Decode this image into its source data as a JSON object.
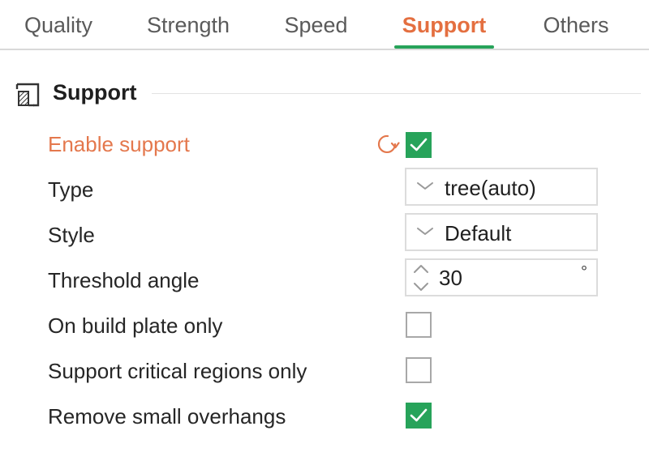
{
  "tabs": [
    {
      "label": "Quality",
      "active": false
    },
    {
      "label": "Strength",
      "active": false
    },
    {
      "label": "Speed",
      "active": false
    },
    {
      "label": "Support",
      "active": true
    },
    {
      "label": "Others",
      "active": false
    }
  ],
  "section": {
    "title": "Support",
    "icon": "support-icon"
  },
  "options": {
    "enable_support": {
      "label": "Enable support",
      "checked": true,
      "modified": true
    },
    "type": {
      "label": "Type",
      "value": "tree(auto)"
    },
    "style": {
      "label": "Style",
      "value": "Default"
    },
    "threshold_angle": {
      "label": "Threshold angle",
      "value": "30",
      "unit": "°"
    },
    "on_build_plate_only": {
      "label": "On build plate only",
      "checked": false
    },
    "support_critical_regions_only": {
      "label": "Support critical regions only",
      "checked": false
    },
    "remove_small_overhangs": {
      "label": "Remove small overhangs",
      "checked": true
    }
  },
  "colors": {
    "accent": "#e46f40",
    "active_underline": "#27a35a",
    "checkbox_checked": "#27a35a",
    "modified_label": "#e4784d"
  }
}
